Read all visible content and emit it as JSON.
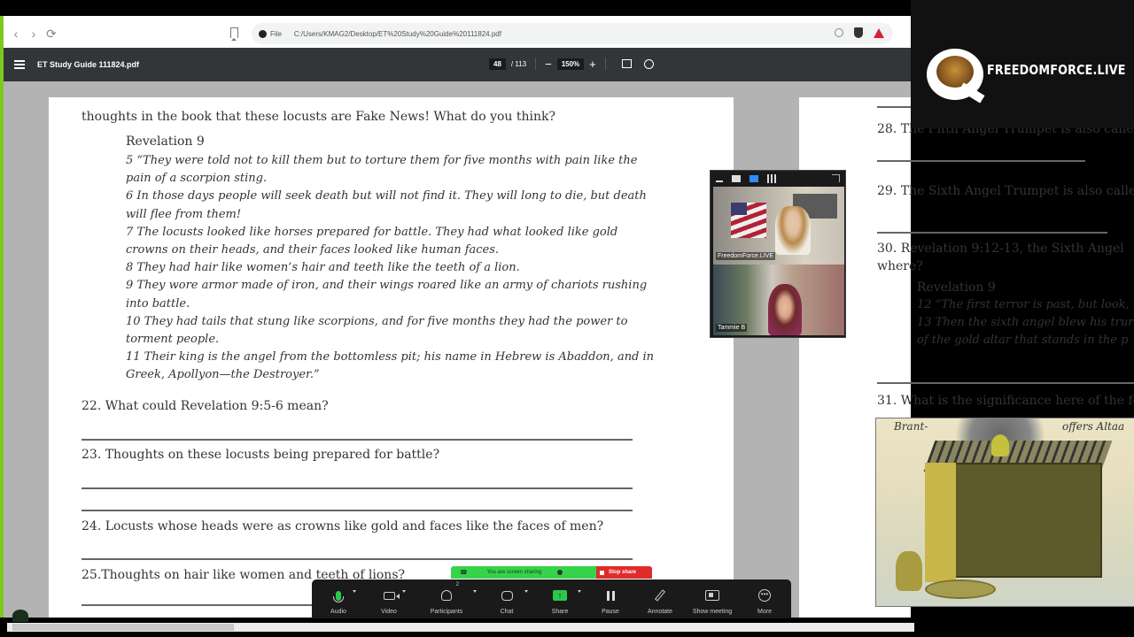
{
  "browser": {
    "address_prefix": "File",
    "url": "C:/Users/KMAG2/Desktop/ET%20Study%20Guide%20111824.pdf"
  },
  "pdf_toolbar": {
    "title": "ET Study Guide 111824.pdf",
    "current_page": "48",
    "total_pages": "/ 113",
    "zoom": "150%",
    "zoom_out": "−",
    "zoom_in": "+"
  },
  "left_page": {
    "intro_line": "thoughts in the book that these locusts are Fake News! What do you think?",
    "passage_heading": "Revelation 9",
    "verses": [
      "5 “They were told not to kill them but to torture them for five months with pain like the pain of a scorpion sting.",
      "6 In those days people will seek death but will not find it. They will long to die, but death will flee from them!",
      "7 The locusts looked like horses prepared for battle. They had what looked like gold crowns on their heads, and their faces looked like human faces.",
      "8 They had hair like women’s hair and teeth like the teeth of a lion.",
      "9 They wore armor made of iron, and their wings roared like an army of chariots rushing into battle.",
      "10 They had tails that stung like scorpions, and for five months they had the power to torment people.",
      "11 Their king is the angel from the bottomless pit; his name in Hebrew is Abaddon, and in Greek, Apollyon—the Destroyer.”"
    ],
    "questions": [
      "22. What could Revelation 9:5-6 mean?",
      "23. Thoughts on these locusts being prepared for battle?",
      "24. Locusts whose heads were as crowns like gold and faces like the faces of men?",
      "25.Thoughts on hair like women and teeth of lions?"
    ]
  },
  "right_page": {
    "q28": "28. The Fifth Angel Trumpet is also calle",
    "q29": "29. The Sixth Angel Trumpet is also calle",
    "q30_line1": "30. Revelation 9:12-13, the Sixth Angel",
    "q30_line2": "where?",
    "passage_heading": "Revelation 9",
    "verses": [
      "12 “The first terror is past, but look,",
      "13 Then the sixth angel blew his trur",
      "of the gold altar that stands in the p"
    ],
    "q31": "31. What is the significance here of the fo",
    "image_caption_left": "Brant-",
    "image_caption_right": "offers Altaa"
  },
  "overlay": {
    "logo_text": "FREEDOMFORCE.LIVE"
  },
  "video_panel": {
    "participants": [
      {
        "name": "FreedomForce.LIVE"
      },
      {
        "name": "Tammie B"
      }
    ]
  },
  "zoom_meeting": {
    "share_banner": "You are screen sharing",
    "stop_share": "Stop share",
    "participant_count": "2",
    "controls": [
      {
        "label": "Audio"
      },
      {
        "label": "Video"
      },
      {
        "label": "Participants"
      },
      {
        "label": "Chat"
      },
      {
        "label": "Share"
      },
      {
        "label": "Pause"
      },
      {
        "label": "Annotate"
      },
      {
        "label": "Show meeting"
      },
      {
        "label": "More"
      }
    ]
  }
}
